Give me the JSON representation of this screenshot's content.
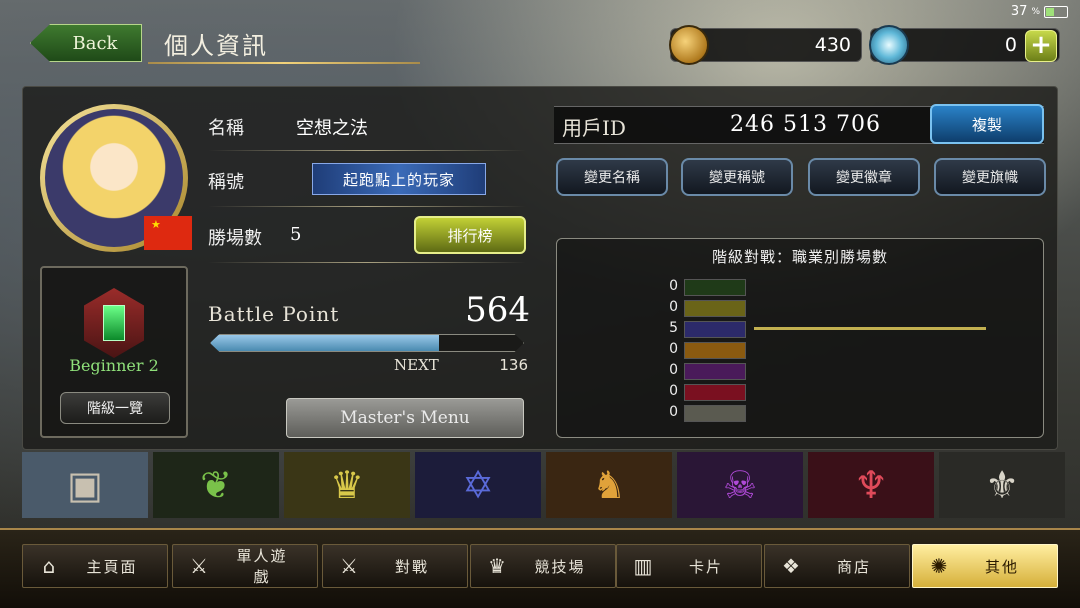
{
  "status": {
    "battery": "37",
    "battery_unit": "%"
  },
  "header": {
    "back_label": "Back",
    "title": "個人資訊",
    "coins": "430",
    "crystals": "0",
    "plus_label": "+"
  },
  "profile": {
    "name_label": "名稱",
    "name_value": "空想之法",
    "title_label": "稱號",
    "title_value": "起跑點上的玩家",
    "wins_label": "勝場數",
    "wins_value": "5",
    "leaderboard_button": "排行榜",
    "battle_point_label": "Battle Point",
    "battle_point_value": "564",
    "battle_point_progress": 0.73,
    "next_label": "NEXT",
    "next_value": "136",
    "masters_menu_button": "Master's Menu"
  },
  "rank": {
    "label": "Beginner 2",
    "list_button": "階級一覽"
  },
  "account": {
    "uid_label": "用戶ID",
    "uid_value": "246 513 706",
    "copy_button": "複製",
    "change_buttons": [
      "變更名稱",
      "變更稱號",
      "變更徽章",
      "變更旗幟"
    ]
  },
  "class_wins": {
    "title": "階級對戰：職業別勝場數",
    "rows": [
      {
        "count": "0",
        "color": "#1f3a18"
      },
      {
        "count": "0",
        "color": "#6a6418"
      },
      {
        "count": "5",
        "color": "#2c2a6a"
      },
      {
        "count": "0",
        "color": "#8a5a10"
      },
      {
        "count": "0",
        "color": "#4a1a5a"
      },
      {
        "count": "0",
        "color": "#7a1020"
      },
      {
        "count": "0",
        "color": "#5a5a50"
      }
    ]
  },
  "class_tabs": [
    {
      "icon": "card-icon",
      "glyph": "▣",
      "color": "#4a5a6a",
      "glyph_color": "#c8c0b0"
    },
    {
      "icon": "leaf-icon",
      "glyph": "❦",
      "color": "#1e2618",
      "glyph_color": "#7ac24a"
    },
    {
      "icon": "crown-icon",
      "glyph": "♛",
      "color": "#3a3616",
      "glyph_color": "#d8c84a"
    },
    {
      "icon": "hexagram-icon",
      "glyph": "✡",
      "color": "#1c1c3a",
      "glyph_color": "#5a6ad8"
    },
    {
      "icon": "dragon-icon",
      "glyph": "♞",
      "color": "#3a2612",
      "glyph_color": "#e0a23a"
    },
    {
      "icon": "skull-icon",
      "glyph": "☠",
      "color": "#2a1636",
      "glyph_color": "#b04ad8"
    },
    {
      "icon": "bat-icon",
      "glyph": "♆",
      "color": "#3a1018",
      "glyph_color": "#e04a5a"
    },
    {
      "icon": "wings-icon",
      "glyph": "⚜",
      "color": "#2a2a26",
      "glyph_color": "#d8d4c8"
    }
  ],
  "nav": [
    {
      "label": "主頁面",
      "icon": "home-icon",
      "glyph": "⌂"
    },
    {
      "label": "單人遊戲",
      "icon": "sword-shield-icon",
      "glyph": "⚔"
    },
    {
      "label": "對戰",
      "icon": "crossed-swords-icon",
      "glyph": "⚔"
    },
    {
      "label": "競技場",
      "icon": "arena-icon",
      "glyph": "♛"
    },
    {
      "label": "卡片",
      "icon": "cards-icon",
      "glyph": "▥"
    },
    {
      "label": "商店",
      "icon": "shop-icon",
      "glyph": "❖"
    },
    {
      "label": "其他",
      "icon": "other-icon",
      "glyph": "✺",
      "active": true
    }
  ]
}
